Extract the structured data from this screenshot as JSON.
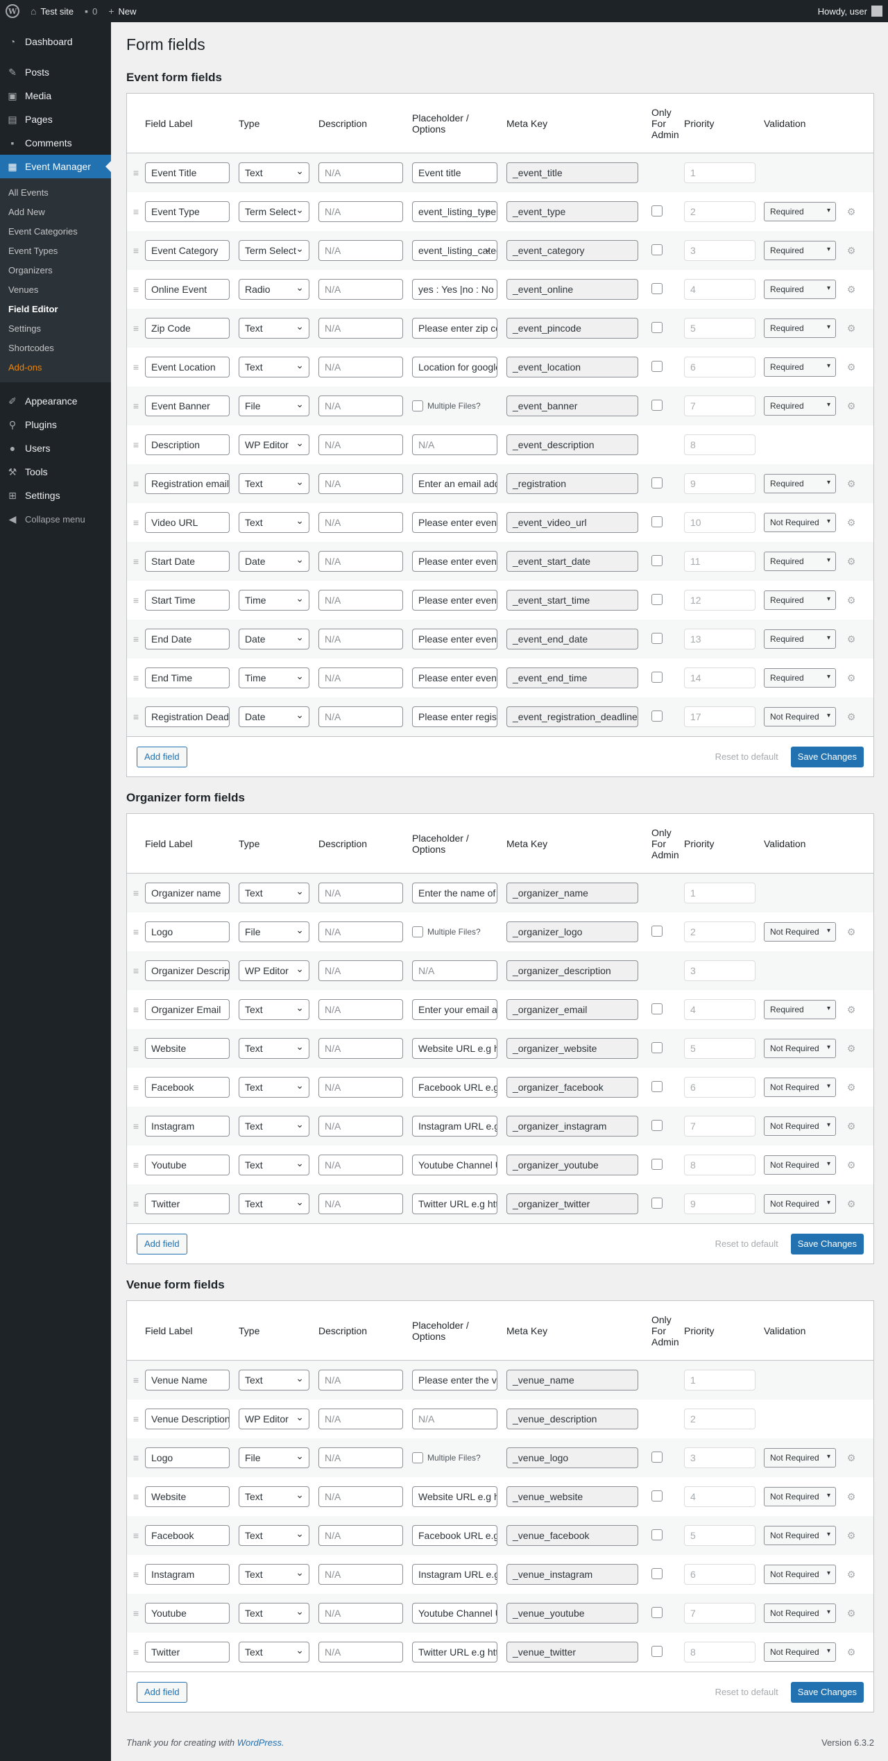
{
  "adminbar": {
    "site_name": "Test site",
    "comments_count": "0",
    "new_label": "New",
    "howdy": "Howdy, user"
  },
  "sidebar": {
    "dashboard": "Dashboard",
    "posts": "Posts",
    "media": "Media",
    "pages": "Pages",
    "comments": "Comments",
    "event_manager": "Event Manager",
    "sub": [
      "All Events",
      "Add New",
      "Event Categories",
      "Event Types",
      "Organizers",
      "Venues",
      "Field Editor",
      "Settings",
      "Shortcodes",
      "Add-ons"
    ],
    "appearance": "Appearance",
    "plugins": "Plugins",
    "users": "Users",
    "tools": "Tools",
    "settings": "Settings",
    "collapse": "Collapse menu"
  },
  "page": {
    "title": "Form fields"
  },
  "columns": {
    "label": "Field Label",
    "type": "Type",
    "description": "Description",
    "placeholder": "Placeholder / Options",
    "meta": "Meta Key",
    "admin": "Only For Admin",
    "priority": "Priority",
    "validation": "Validation"
  },
  "buttons": {
    "add": "Add field",
    "reset": "Reset to default",
    "save": "Save Changes"
  },
  "sections": [
    {
      "title": "Event form fields",
      "rows": [
        {
          "label": "Event Title",
          "type": "Text",
          "desc": "N/A",
          "ph": "Event title",
          "meta": "_event_title",
          "admin": false,
          "priority": "1",
          "validation": ""
        },
        {
          "label": "Event Type",
          "type": "Term Select",
          "desc": "N/A",
          "ph": "event_listing_type",
          "ph_select": true,
          "meta": "_event_type",
          "admin": true,
          "priority": "2",
          "validation": "Required"
        },
        {
          "label": "Event Category",
          "type": "Term Select",
          "desc": "N/A",
          "ph": "event_listing_category",
          "ph_select": true,
          "meta": "_event_category",
          "admin": true,
          "priority": "3",
          "validation": "Required"
        },
        {
          "label": "Online Event",
          "type": "Radio",
          "desc": "N/A",
          "ph": "yes : Yes |no : No",
          "meta": "_event_online",
          "admin": true,
          "priority": "4",
          "validation": "Required"
        },
        {
          "label": "Zip Code",
          "type": "Text",
          "desc": "N/A",
          "ph": "Please enter zip code",
          "meta": "_event_pincode",
          "admin": true,
          "priority": "5",
          "validation": "Required"
        },
        {
          "label": "Event Location",
          "type": "Text",
          "desc": "N/A",
          "ph": "Location for google map",
          "meta": "_event_location",
          "admin": true,
          "priority": "6",
          "validation": "Required"
        },
        {
          "label": "Event Banner",
          "type": "File",
          "desc": "N/A",
          "ph": "Multiple Files?",
          "ph_multi": true,
          "meta": "_event_banner",
          "admin": true,
          "priority": "7",
          "validation": "Required"
        },
        {
          "label": "Description",
          "type": "WP Editor",
          "desc": "N/A",
          "ph": "N/A",
          "ph_na": true,
          "meta": "_event_description",
          "admin": false,
          "priority": "8",
          "validation": ""
        },
        {
          "label": "Registration email/URL",
          "type": "Text",
          "desc": "N/A",
          "ph": "Enter an email address",
          "meta": "_registration",
          "admin": true,
          "priority": "9",
          "validation": "Required"
        },
        {
          "label": "Video URL",
          "type": "Text",
          "desc": "N/A",
          "ph": "Please enter event video url",
          "meta": "_event_video_url",
          "admin": true,
          "priority": "10",
          "validation": "Not Required"
        },
        {
          "label": "Start Date",
          "type": "Date",
          "desc": "N/A",
          "ph": "Please enter event start date",
          "meta": "_event_start_date",
          "admin": true,
          "priority": "11",
          "validation": "Required"
        },
        {
          "label": "Start Time",
          "type": "Time",
          "desc": "N/A",
          "ph": "Please enter event start time",
          "meta": "_event_start_time",
          "admin": true,
          "priority": "12",
          "validation": "Required"
        },
        {
          "label": "End Date",
          "type": "Date",
          "desc": "N/A",
          "ph": "Please enter event end date",
          "meta": "_event_end_date",
          "admin": true,
          "priority": "13",
          "validation": "Required"
        },
        {
          "label": "End Time",
          "type": "Time",
          "desc": "N/A",
          "ph": "Please enter event end time",
          "meta": "_event_end_time",
          "admin": true,
          "priority": "14",
          "validation": "Required"
        },
        {
          "label": "Registration Deadline",
          "type": "Date",
          "desc": "N/A",
          "ph": "Please enter registration deadline",
          "meta": "_event_registration_deadline",
          "admin": true,
          "priority": "17",
          "validation": "Not Required"
        }
      ]
    },
    {
      "title": "Organizer form fields",
      "rows": [
        {
          "label": "Organizer name",
          "type": "Text",
          "desc": "N/A",
          "ph": "Enter the name of the organizer",
          "meta": "_organizer_name",
          "admin": false,
          "priority": "1",
          "validation": ""
        },
        {
          "label": "Logo",
          "type": "File",
          "desc": "N/A",
          "ph": "Multiple Files?",
          "ph_multi": true,
          "meta": "_organizer_logo",
          "admin": true,
          "priority": "2",
          "validation": "Not Required"
        },
        {
          "label": "Organizer Description",
          "type": "WP Editor",
          "desc": "N/A",
          "ph": "N/A",
          "ph_na": true,
          "meta": "_organizer_description",
          "admin": false,
          "priority": "3",
          "validation": ""
        },
        {
          "label": "Organizer Email",
          "type": "Text",
          "desc": "N/A",
          "ph": "Enter your email address",
          "meta": "_organizer_email",
          "admin": true,
          "priority": "4",
          "validation": "Required"
        },
        {
          "label": "Website",
          "type": "Text",
          "desc": "N/A",
          "ph": "Website URL e.g http://www.yourorganization.com",
          "meta": "_organizer_website",
          "admin": true,
          "priority": "5",
          "validation": "Not Required"
        },
        {
          "label": "Facebook",
          "type": "Text",
          "desc": "N/A",
          "ph": "Facebook URL e.g http://www.facebook.com/yourorganizer",
          "meta": "_organizer_facebook",
          "admin": true,
          "priority": "6",
          "validation": "Not Required"
        },
        {
          "label": "Instagram",
          "type": "Text",
          "desc": "N/A",
          "ph": "Instagram URL e.g http://www.instagram.com/yourorganizer",
          "meta": "_organizer_instagram",
          "admin": true,
          "priority": "7",
          "validation": "Not Required"
        },
        {
          "label": "Youtube",
          "type": "Text",
          "desc": "N/A",
          "ph": "Youtube Channel URL e.g http://www.youtube.com/channel/yourorganizer",
          "meta": "_organizer_youtube",
          "admin": true,
          "priority": "8",
          "validation": "Not Required"
        },
        {
          "label": "Twitter",
          "type": "Text",
          "desc": "N/A",
          "ph": "Twitter URL e.g http://twitter.com/yourorganizer",
          "meta": "_organizer_twitter",
          "admin": true,
          "priority": "9",
          "validation": "Not Required"
        }
      ]
    },
    {
      "title": "Venue form fields",
      "rows": [
        {
          "label": "Venue Name",
          "type": "Text",
          "desc": "N/A",
          "ph": "Please enter the venue name",
          "meta": "_venue_name",
          "admin": false,
          "priority": "1",
          "validation": ""
        },
        {
          "label": "Venue Description",
          "type": "WP Editor",
          "desc": "N/A",
          "ph": "N/A",
          "ph_na": true,
          "meta": "_venue_description",
          "admin": false,
          "priority": "2",
          "validation": ""
        },
        {
          "label": "Logo",
          "type": "File",
          "desc": "N/A",
          "ph": "Multiple Files?",
          "ph_multi": true,
          "meta": "_venue_logo",
          "admin": true,
          "priority": "3",
          "validation": "Not Required"
        },
        {
          "label": "Website",
          "type": "Text",
          "desc": "N/A",
          "ph": "Website URL e.g http://www.yourvenue.com",
          "meta": "_venue_website",
          "admin": true,
          "priority": "4",
          "validation": "Not Required"
        },
        {
          "label": "Facebook",
          "type": "Text",
          "desc": "N/A",
          "ph": "Facebook URL e.g http://www.facebook.com/yourvenue",
          "meta": "_venue_facebook",
          "admin": true,
          "priority": "5",
          "validation": "Not Required"
        },
        {
          "label": "Instagram",
          "type": "Text",
          "desc": "N/A",
          "ph": "Instagram URL e.g http://www.instagram.com/yourvenue",
          "meta": "_venue_instagram",
          "admin": true,
          "priority": "6",
          "validation": "Not Required"
        },
        {
          "label": "Youtube",
          "type": "Text",
          "desc": "N/A",
          "ph": "Youtube Channel URL e.g http://www.youtube.com/channel/yourvenue",
          "meta": "_venue_youtube",
          "admin": true,
          "priority": "7",
          "validation": "Not Required"
        },
        {
          "label": "Twitter",
          "type": "Text",
          "desc": "N/A",
          "ph": "Twitter URL e.g http://twitter.com/yourvenue",
          "meta": "_venue_twitter",
          "admin": true,
          "priority": "8",
          "validation": "Not Required"
        }
      ]
    }
  ],
  "footer": {
    "thanks": "Thank you for creating with",
    "wp_link": "WordPress.",
    "version": "Version 6.3.2"
  },
  "colors": {
    "accent": "#2271b1",
    "sidebar": "#1d2327",
    "addons": "#f18500"
  }
}
